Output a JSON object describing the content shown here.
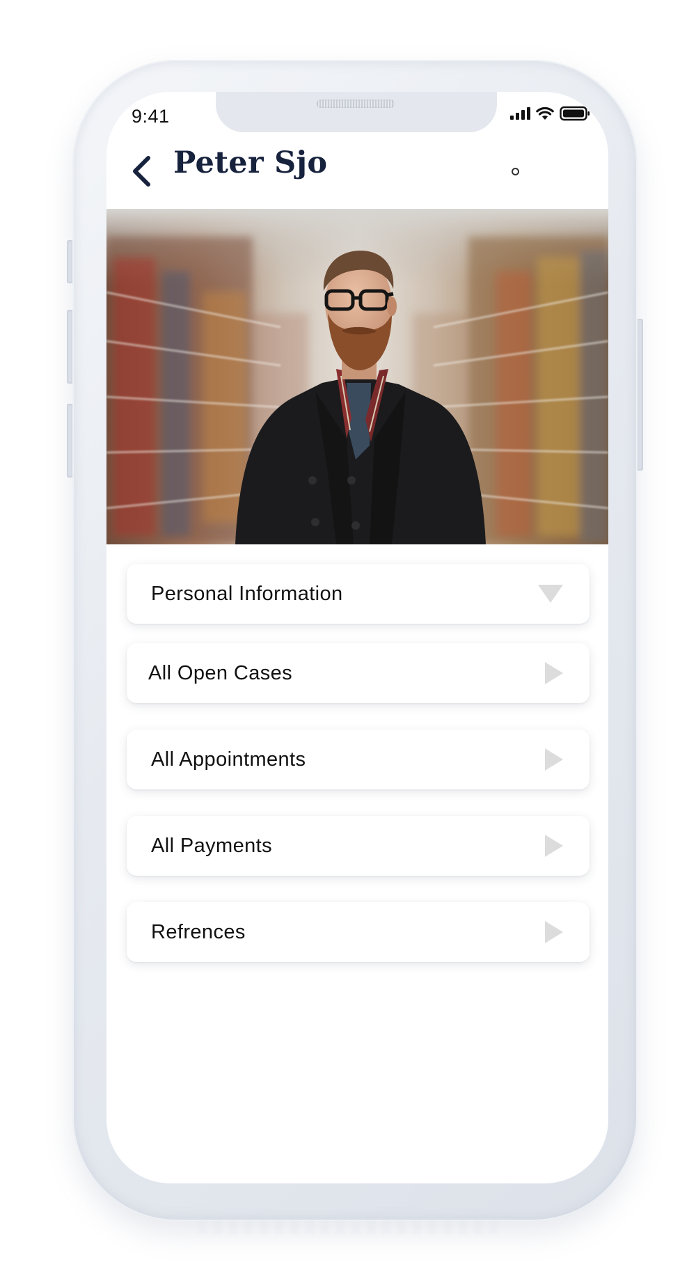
{
  "status_bar": {
    "time": "9:41",
    "icons": [
      "cellular-signal-icon",
      "wifi-icon",
      "battery-icon"
    ]
  },
  "header": {
    "back_icon": "chevron-left-icon",
    "title": "Peter Sjo"
  },
  "profile_photo": {
    "description_icon": "profile-photo"
  },
  "menu": {
    "items": [
      {
        "label": "Personal Information",
        "icon": "triangle-down-icon",
        "expanded": true
      },
      {
        "label": "All Open Cases",
        "icon": "triangle-right-icon",
        "expanded": false
      },
      {
        "label": "All Appointments",
        "icon": "triangle-right-icon",
        "expanded": false
      },
      {
        "label": "All Payments",
        "icon": "triangle-right-icon",
        "expanded": false
      },
      {
        "label": "Refrences",
        "icon": "triangle-right-icon",
        "expanded": false
      }
    ]
  },
  "colors": {
    "title": "#17223d",
    "text": "#111111",
    "arrow": "#dcdcdc",
    "phone_frame": "#e6eaf0",
    "screen_bg": "#ffffff"
  }
}
